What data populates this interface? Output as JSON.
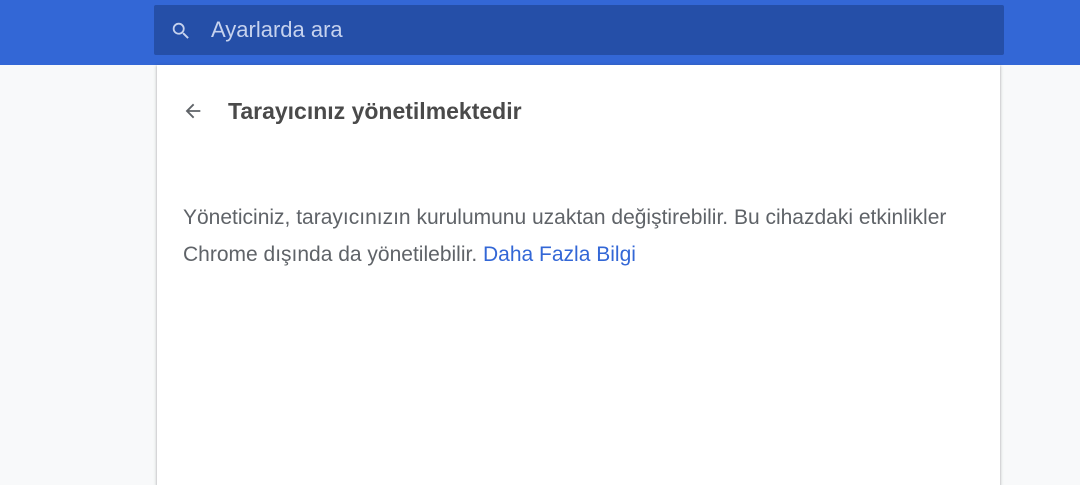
{
  "search": {
    "placeholder": "Ayarlarda ara"
  },
  "page": {
    "title": "Tarayıcınız yönetilmektedir",
    "description": "Yöneticiniz, tarayıcınızın kurulumunu uzaktan değiştirebilir. Bu cihazdaki etkinlikler Chrome dışında da yönetilebilir.",
    "learn_more_label": "Daha Fazla Bilgi"
  },
  "icons": {
    "search": "search-icon",
    "back": "arrow-back-icon"
  },
  "colors": {
    "toolbar": "#3367d6",
    "search_box": "#254fa8",
    "link": "#3367d6",
    "background": "#f8f9fa"
  }
}
